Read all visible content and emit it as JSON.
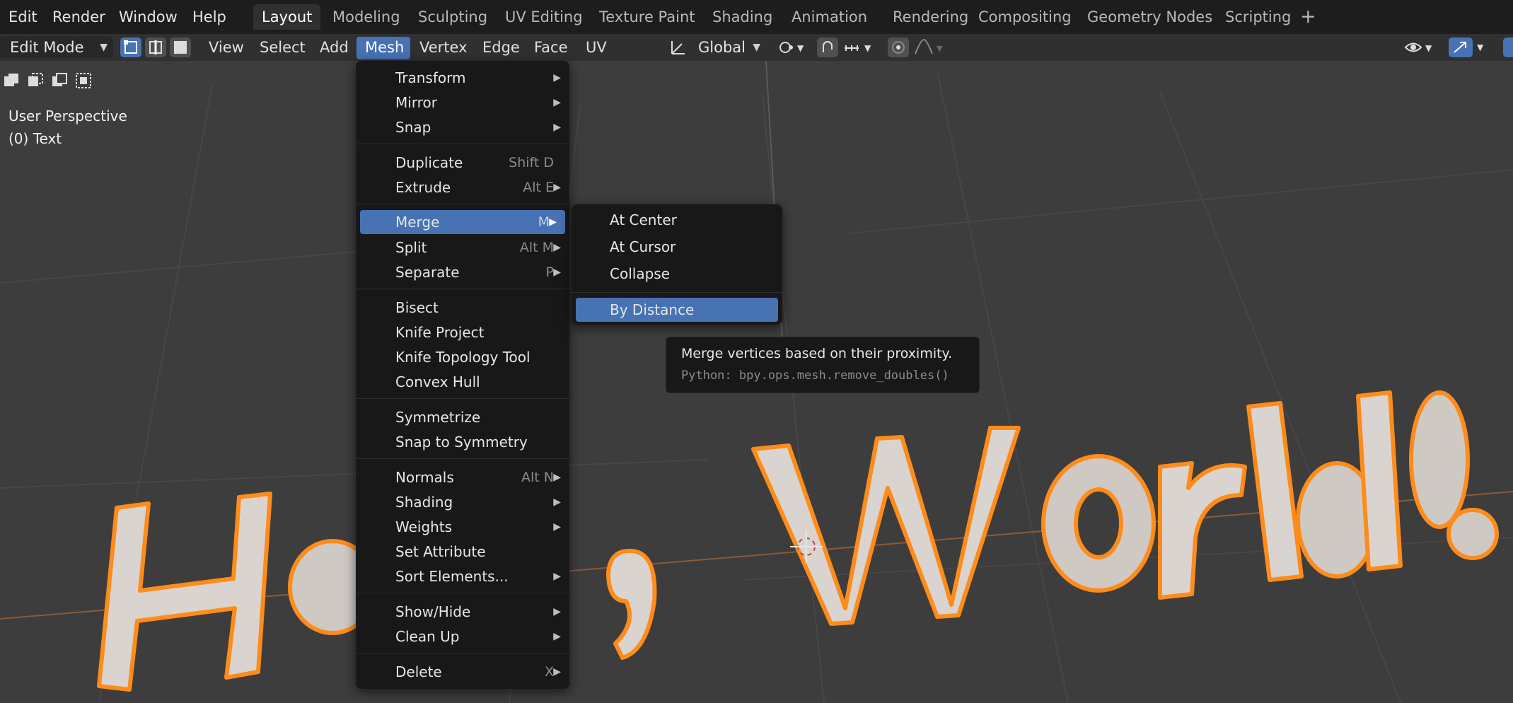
{
  "topbar": {
    "menus": [
      "Edit",
      "Render",
      "Window",
      "Help"
    ],
    "workspaces": [
      "Layout",
      "Modeling",
      "Sculpting",
      "UV Editing",
      "Texture Paint",
      "Shading",
      "Animation",
      "Rendering",
      "Compositing",
      "Geometry Nodes",
      "Scripting"
    ],
    "active_workspace": "Layout",
    "add_workspace": "+"
  },
  "header": {
    "mode": "Edit Mode",
    "menus": [
      "View",
      "Select",
      "Add",
      "Mesh",
      "Vertex",
      "Edge",
      "Face",
      "UV"
    ],
    "active_menu": "Mesh",
    "orientation": "Global"
  },
  "viewport": {
    "perspective": "User Perspective",
    "object": "(0) Text",
    "text_object": "Hello, World!"
  },
  "mesh_menu": {
    "items": [
      {
        "label": "Transform",
        "shortcut": "",
        "submenu": true
      },
      {
        "label": "Mirror",
        "shortcut": "",
        "submenu": true
      },
      {
        "label": "Snap",
        "shortcut": "",
        "submenu": true
      },
      {
        "label": "Duplicate",
        "shortcut": "Shift D",
        "submenu": false
      },
      {
        "label": "Extrude",
        "shortcut": "Alt E",
        "submenu": true
      },
      {
        "label": "Merge",
        "shortcut": "M",
        "submenu": true
      },
      {
        "label": "Split",
        "shortcut": "Alt M",
        "submenu": true
      },
      {
        "label": "Separate",
        "shortcut": "P",
        "submenu": true
      },
      {
        "label": "Bisect",
        "shortcut": "",
        "submenu": false
      },
      {
        "label": "Knife Project",
        "shortcut": "",
        "submenu": false
      },
      {
        "label": "Knife Topology Tool",
        "shortcut": "",
        "submenu": false
      },
      {
        "label": "Convex Hull",
        "shortcut": "",
        "submenu": false
      },
      {
        "label": "Symmetrize",
        "shortcut": "",
        "submenu": false
      },
      {
        "label": "Snap to Symmetry",
        "shortcut": "",
        "submenu": false
      },
      {
        "label": "Normals",
        "shortcut": "Alt N",
        "submenu": true
      },
      {
        "label": "Shading",
        "shortcut": "",
        "submenu": true
      },
      {
        "label": "Weights",
        "shortcut": "",
        "submenu": true
      },
      {
        "label": "Set Attribute",
        "shortcut": "",
        "submenu": false
      },
      {
        "label": "Sort Elements...",
        "shortcut": "",
        "submenu": true
      },
      {
        "label": "Show/Hide",
        "shortcut": "",
        "submenu": true
      },
      {
        "label": "Clean Up",
        "shortcut": "",
        "submenu": true
      },
      {
        "label": "Delete",
        "shortcut": "X",
        "submenu": true
      }
    ],
    "highlighted": "Merge"
  },
  "merge_submenu": {
    "items": [
      "At Center",
      "At Cursor",
      "Collapse",
      "By Distance"
    ],
    "highlighted": "By Distance"
  },
  "tooltip": {
    "description": "Merge vertices based on their proximity.",
    "python": "Python: bpy.ops.mesh.remove_doubles()"
  },
  "colors": {
    "accent": "#4772b3",
    "selection": "#ff8c1a",
    "viewport_bg": "#3d3d3d",
    "menu_bg": "#181818"
  }
}
